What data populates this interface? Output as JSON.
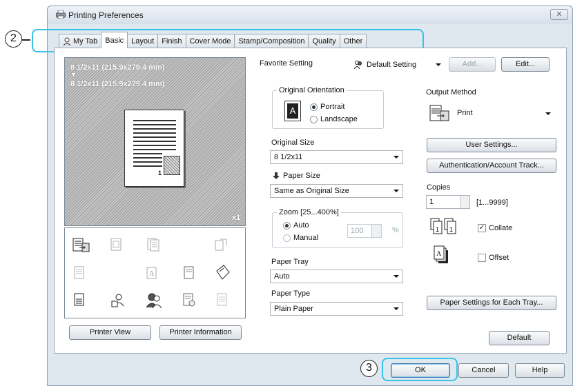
{
  "window": {
    "title": "Printing Preferences",
    "close_label": "✕"
  },
  "callouts": {
    "tabs": "2",
    "ok": "3"
  },
  "tabs": [
    {
      "label": "My Tab"
    },
    {
      "label": "Basic"
    },
    {
      "label": "Layout"
    },
    {
      "label": "Finish"
    },
    {
      "label": "Cover Mode"
    },
    {
      "label": "Stamp/Composition"
    },
    {
      "label": "Quality"
    },
    {
      "label": "Other"
    }
  ],
  "preview": {
    "original_size": "8 1/2x11 (215.9x279.4 mm)",
    "arrow": "▼",
    "paper_size": "8 1/2x11 (215.9x279.4 mm)",
    "page_number": "1",
    "copies_badge": "x1"
  },
  "left_buttons": {
    "printer_view": "Printer View",
    "printer_information": "Printer Information"
  },
  "favorite": {
    "label": "Favorite Setting",
    "value": "Default Setting",
    "add": "Add...",
    "edit": "Edit..."
  },
  "orientation": {
    "title": "Original Orientation",
    "portrait": "Portrait",
    "landscape": "Landscape",
    "icon_letter": "A"
  },
  "original_size": {
    "label": "Original Size",
    "value": "8 1/2x11"
  },
  "paper_size": {
    "label": "Paper Size",
    "value": "Same as Original Size"
  },
  "zoom": {
    "title": "Zoom [25...400%]",
    "auto": "Auto",
    "manual": "Manual",
    "value": "100",
    "unit": "%"
  },
  "paper_tray": {
    "label": "Paper Tray",
    "value": "Auto"
  },
  "paper_type": {
    "label": "Paper Type",
    "value": "Plain Paper"
  },
  "output": {
    "label": "Output Method",
    "value": "Print"
  },
  "right_buttons": {
    "user_settings": "User Settings...",
    "authentication": "Authentication/Account Track...",
    "paper_settings": "Paper Settings for Each Tray...",
    "default": "Default"
  },
  "copies": {
    "label": "Copies",
    "value": "1",
    "range": "[1...9999]"
  },
  "collate": {
    "label": "Collate",
    "checked": true,
    "mark": "✓"
  },
  "offset": {
    "label": "Offset",
    "checked": false
  },
  "footer": {
    "ok": "OK",
    "cancel": "Cancel",
    "help": "Help"
  }
}
